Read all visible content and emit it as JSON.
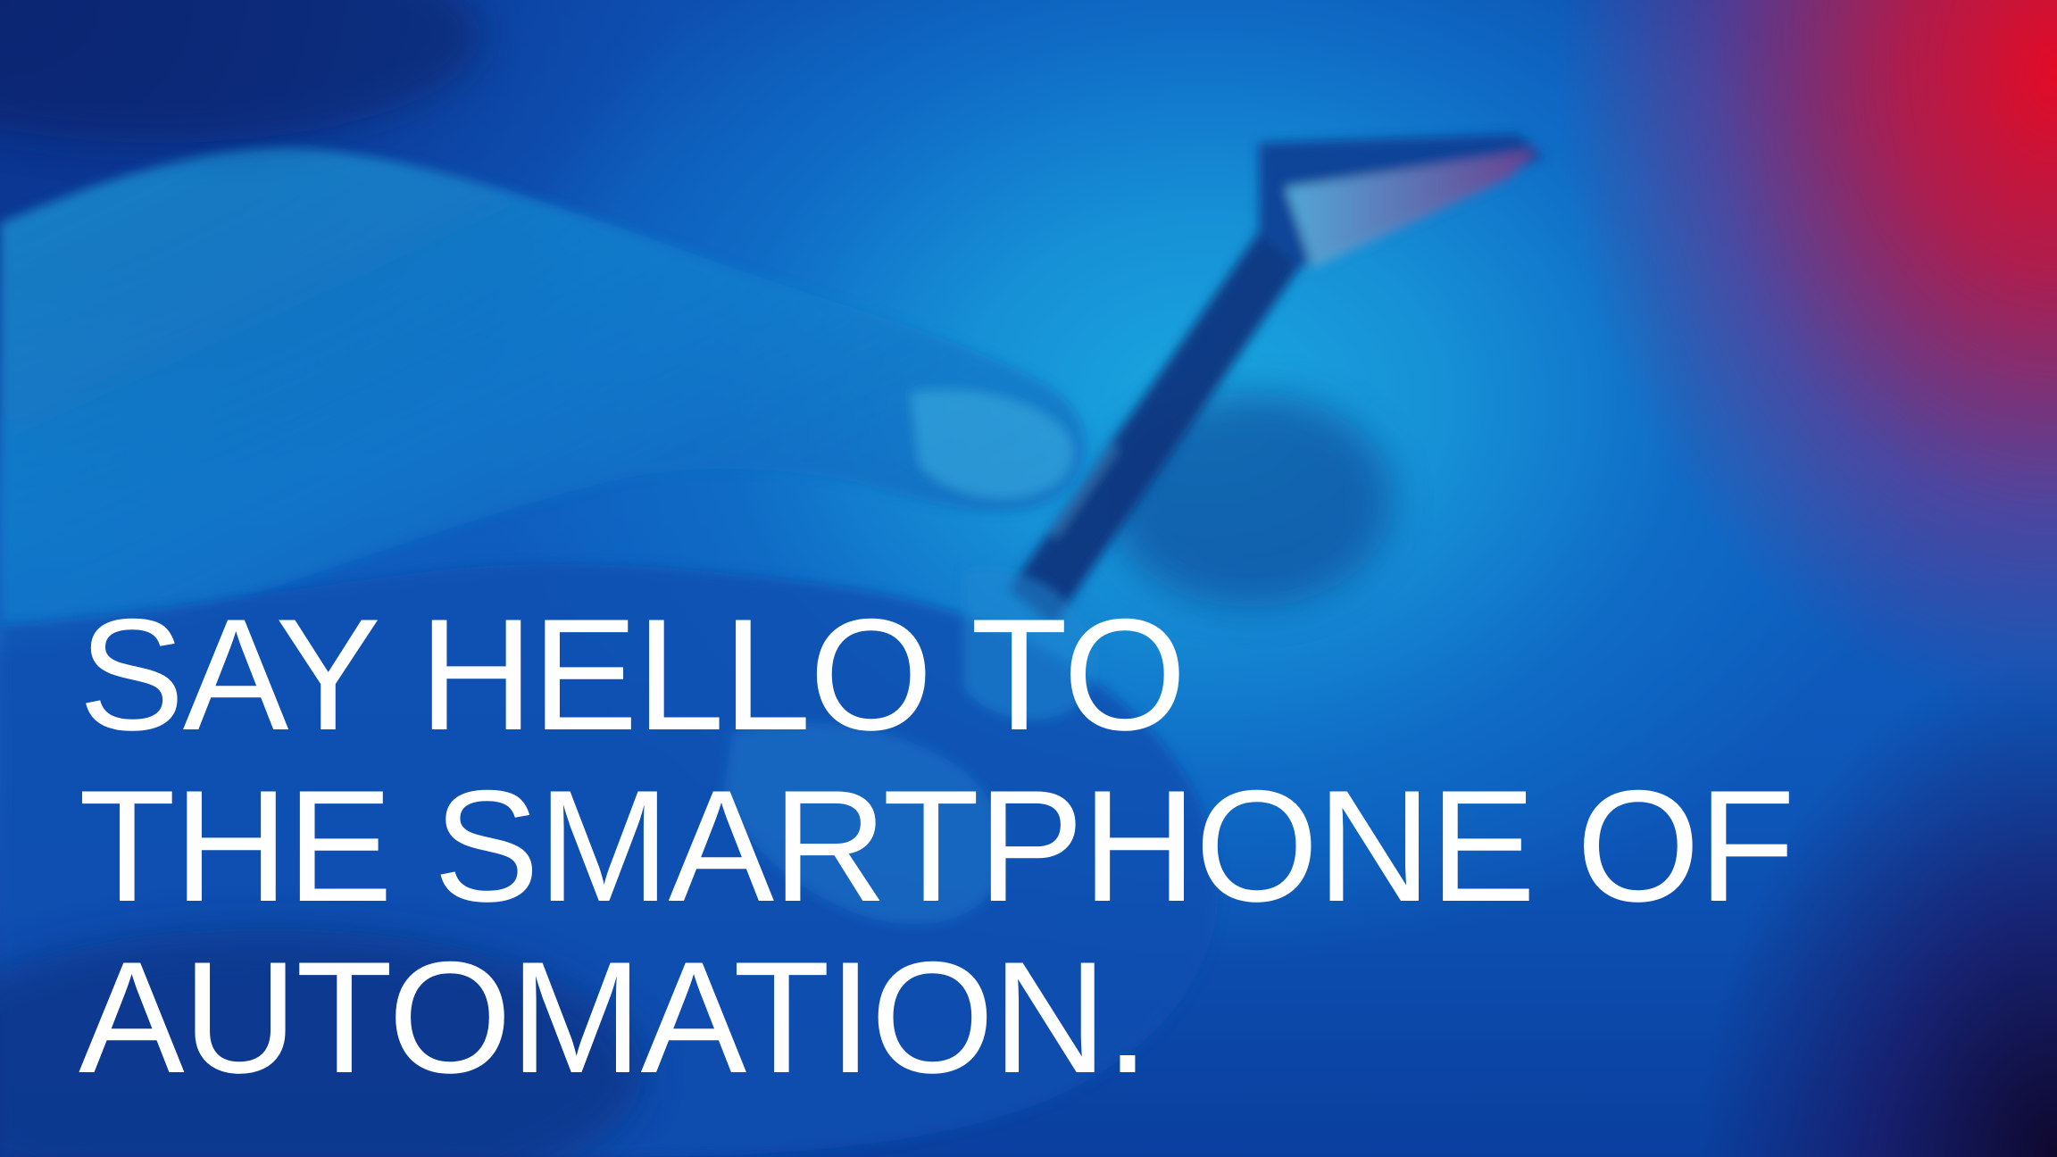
{
  "headline": {
    "line1": "SAY HELLO TO",
    "line2": "THE SMARTPHONE OF",
    "line3": "AUTOMATION."
  },
  "colors": {
    "text": "#ffffff",
    "primary_blue": "#0f6cc6",
    "accent_red": "#e60a23"
  },
  "image": {
    "subject": "hand-holding-smartphone-photo"
  }
}
